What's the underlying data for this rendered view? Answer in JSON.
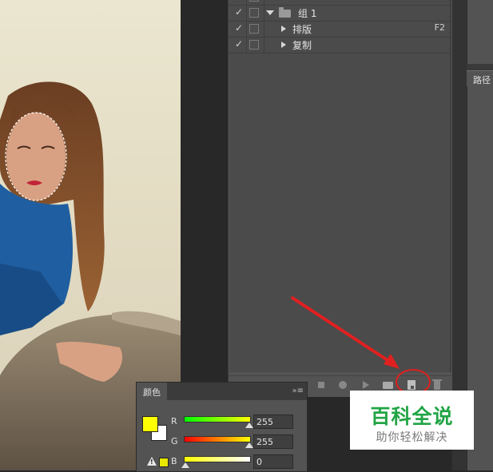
{
  "actions": {
    "rows": [
      {
        "checked": "✓",
        "label": "",
        "shortcut": ""
      },
      {
        "checked": "✓",
        "label": "组 1",
        "shortcut": ""
      },
      {
        "checked": "✓",
        "label": "排版",
        "shortcut": "F2"
      },
      {
        "checked": "✓",
        "label": "复制",
        "shortcut": ""
      }
    ]
  },
  "right_dock": {
    "paths_tab": "路径"
  },
  "color_panel": {
    "tab_label": "颜色",
    "foreground": "#ffff00",
    "background": "#ffffff",
    "channels": [
      {
        "label": "R",
        "value": "255"
      },
      {
        "label": "G",
        "value": "255"
      },
      {
        "label": "B",
        "value": "0"
      }
    ]
  },
  "watermark": {
    "title": "百科全说",
    "subtitle": "助你轻松解决"
  },
  "colors": {
    "annotation": "#e02020",
    "watermark_green": "#22a445"
  }
}
